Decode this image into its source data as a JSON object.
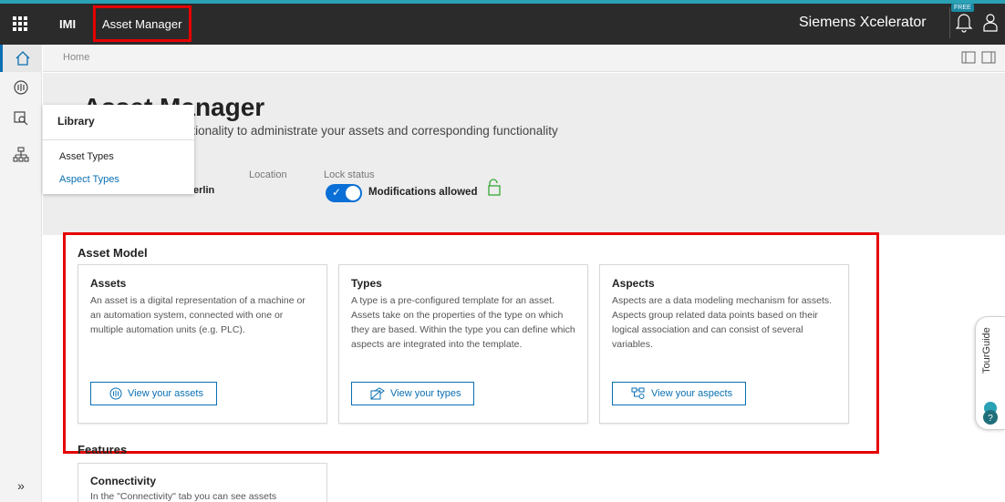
{
  "header": {
    "brand": "IMI",
    "app_name": "Asset Manager",
    "product": "Siemens Xcelerator",
    "free_badge": "FREE"
  },
  "breadcrumb": {
    "home": "Home"
  },
  "hero": {
    "title": "Asset Manager",
    "description": "es you with the functionality to administrate your assets and corresponding functionality",
    "location_label": "Location",
    "tenant_partial": "erlin",
    "lock_status_label": "Lock status",
    "modifications_text": "Modifications allowed"
  },
  "library_menu": {
    "title": "Library",
    "items": [
      "Asset Types",
      "Aspect Types"
    ]
  },
  "asset_model": {
    "title": "Asset Model",
    "cards": [
      {
        "title": "Assets",
        "description": "An asset is a digital representation of a machine or an automation system, connected with one or multiple automation units (e.g. PLC).",
        "button": "View your assets"
      },
      {
        "title": "Types",
        "description": "A type is a pre-configured template for an asset. Assets take on the properties of the type on which they are based. Within the type you can define which aspects are integrated into the template.",
        "button": "View your types"
      },
      {
        "title": "Aspects",
        "description": "Aspects are a data modeling mechanism for assets. Aspects group related data points based on their logical association and can consist of several variables.",
        "button": "View your aspects"
      }
    ]
  },
  "features": {
    "title": "Features",
    "card": {
      "title": "Connectivity",
      "description": "In the \"Connectivity\" tab you can see assets"
    }
  },
  "tour_guide": {
    "label": "TourGuide"
  },
  "rail": {
    "expand": "»"
  },
  "colors": {
    "accent": "#0a6fb3",
    "highlight": "#e60000",
    "topbar": "#2b2b2b"
  }
}
